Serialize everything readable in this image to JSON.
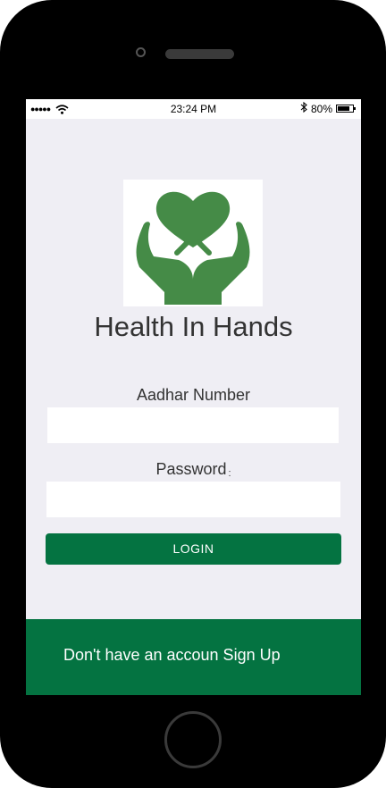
{
  "status_bar": {
    "signal": "●●●●●",
    "time": "23:24 PM",
    "battery": "80%",
    "battery_level": 0.8
  },
  "app": {
    "title": "Health In Hands",
    "logo": "heart-in-hands-icon",
    "brand_color": "#047341",
    "background_color": "#efeef4"
  },
  "form": {
    "aadhar_label": "Aadhar Number",
    "aadhar_value": "",
    "password_label": "Password",
    "password_value": "",
    "login_label": "LOGIN"
  },
  "footer": {
    "signup_text": "Don't have an accoun Sign Up"
  },
  "icons": {
    "wifi": "wifi-icon",
    "bluetooth": "bluetooth-icon",
    "battery": "battery-icon"
  }
}
